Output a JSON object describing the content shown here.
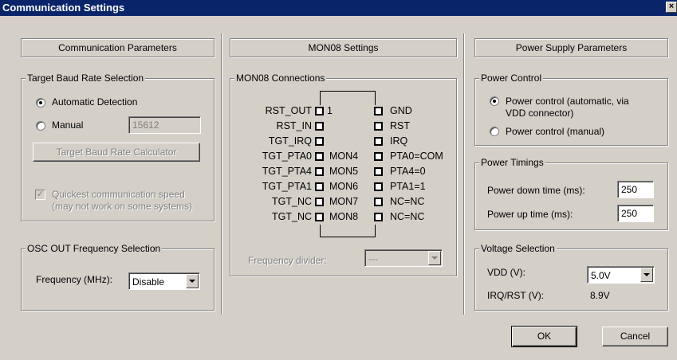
{
  "window": {
    "title": "Communication Settings",
    "close_glyph": "×"
  },
  "comm": {
    "header": "Communication Parameters",
    "baud_group": "Target Baud Rate Selection",
    "auto_label": "Automatic Detection",
    "manual_label": "Manual",
    "manual_value": "15612",
    "calc_button": "Target Baud Rate Calculator",
    "quickest_line1": "Quickest communication speed",
    "quickest_line2": "(may not work on some systems)",
    "osc_group": "OSC OUT Frequency Selection",
    "freq_label": "Frequency (MHz):",
    "freq_value": "Disable"
  },
  "mon08": {
    "header": "MON08 Settings",
    "conn_group": "MON08 Connections",
    "pins": [
      {
        "left": "RST_OUT",
        "num": "1",
        "mon": "",
        "right": "GND"
      },
      {
        "left": "RST_IN",
        "num": "",
        "mon": "",
        "right": "RST"
      },
      {
        "left": "TGT_IRQ",
        "num": "",
        "mon": "",
        "right": "IRQ"
      },
      {
        "left": "TGT_PTA0",
        "num": "",
        "mon": "MON4",
        "right": "PTA0=COM"
      },
      {
        "left": "TGT_PTA4",
        "num": "",
        "mon": "MON5",
        "right": "PTA4=0"
      },
      {
        "left": "TGT_PTA1",
        "num": "",
        "mon": "MON6",
        "right": "PTA1=1"
      },
      {
        "left": "TGT_NC",
        "num": "",
        "mon": "MON7",
        "right": "NC=NC"
      },
      {
        "left": "TGT_NC",
        "num": "",
        "mon": "MON8",
        "right": "NC=NC"
      }
    ],
    "divider_label": "Frequency divider:",
    "divider_value": "---"
  },
  "power": {
    "header": "Power Supply Parameters",
    "control_group": "Power Control",
    "auto_line1": "Power control (automatic, via",
    "auto_line2": "VDD connector)",
    "manual_label": "Power control (manual)",
    "timings_group": "Power Timings",
    "down_label": "Power down time (ms):",
    "down_value": "250",
    "up_label": "Power up time (ms):",
    "up_value": "250",
    "voltage_group": "Voltage Selection",
    "vdd_label": "VDD (V):",
    "vdd_value": "5.0V",
    "irq_label": "IRQ/RST (V):",
    "irq_value": "8.9V"
  },
  "buttons": {
    "ok": "OK",
    "cancel": "Cancel"
  }
}
